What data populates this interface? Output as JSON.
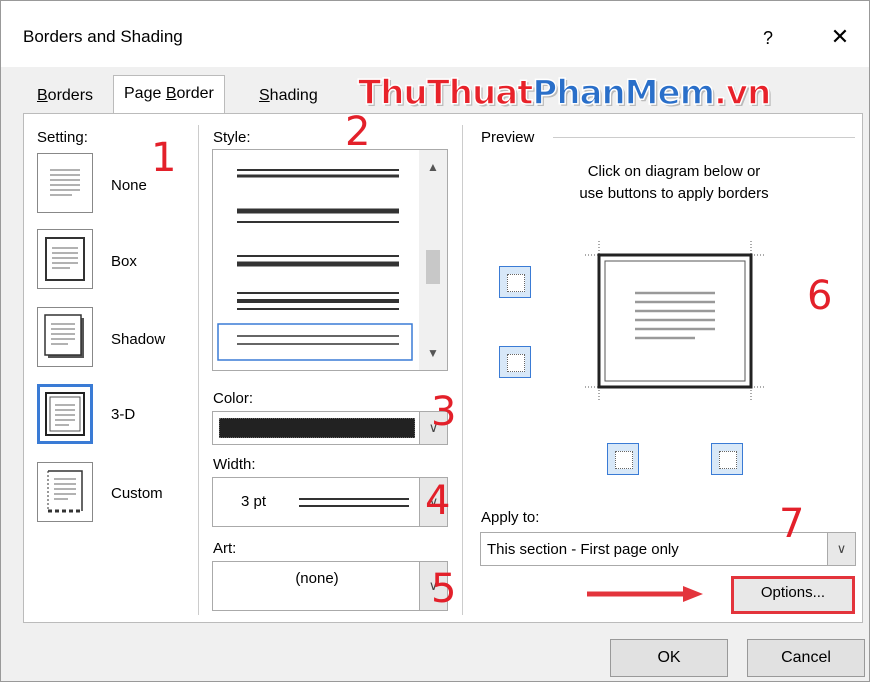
{
  "window": {
    "title": "Borders and Shading",
    "help_glyph": "?",
    "close_glyph": "✕"
  },
  "tabs": [
    {
      "label": "Borders",
      "mnemonic_index": 0,
      "active": false
    },
    {
      "label": "Page Border",
      "mnemonic_index": 5,
      "active": true
    },
    {
      "label": "Shading",
      "mnemonic_index": 0,
      "active": false
    }
  ],
  "watermark": {
    "part1": "ThuThuat",
    "part2": "PhanMem",
    "part3": ".vn"
  },
  "setting": {
    "heading": "Setting:",
    "items": [
      {
        "label": "None",
        "selected": false
      },
      {
        "label": "Box",
        "selected": false
      },
      {
        "label": "Shadow",
        "selected": false
      },
      {
        "label": "3-D",
        "selected": true
      },
      {
        "label": "Custom",
        "selected": false
      }
    ]
  },
  "style": {
    "heading": "Style:"
  },
  "color": {
    "heading": "Color:",
    "value_hex": "#222222"
  },
  "width": {
    "heading": "Width:",
    "value": "3 pt"
  },
  "art": {
    "heading": "Art:",
    "value": "(none)"
  },
  "preview": {
    "heading": "Preview",
    "hint_line1": "Click on diagram below or",
    "hint_line2": "use buttons to apply borders"
  },
  "apply_to": {
    "heading": "Apply to:",
    "value": "This section - First page only"
  },
  "buttons": {
    "options": "Options...",
    "ok": "OK",
    "cancel": "Cancel"
  },
  "annotations": [
    "1",
    "2",
    "3",
    "4",
    "5",
    "6",
    "7"
  ],
  "colors": {
    "highlight": "#e3343c",
    "accent": "#3a7bd5",
    "annotation": "#e3202a"
  }
}
